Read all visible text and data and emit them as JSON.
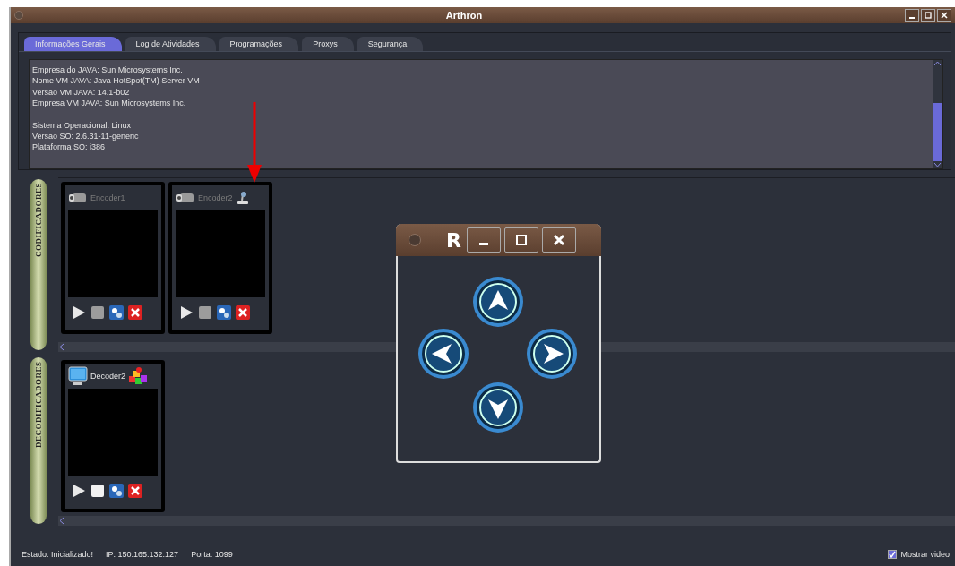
{
  "window": {
    "title": "Arthron"
  },
  "tabs": [
    {
      "label": "Informações Gerais",
      "selected": true
    },
    {
      "label": "Log de Atividades",
      "selected": false
    },
    {
      "label": "Programações",
      "selected": false
    },
    {
      "label": "Proxys",
      "selected": false
    },
    {
      "label": "Segurança",
      "selected": false
    }
  ],
  "info_blocks": [
    [
      "Empresa do JAVA: Sun Microsystems Inc.",
      "Nome VM JAVA: Java HotSpot(TM) Server VM",
      "Versao VM JAVA: 14.1-b02",
      "Empresa VM JAVA: Sun Microsystems Inc."
    ],
    [
      "Sistema Operacional: Linux",
      "Versao SO: 2.6.31-11-generic",
      "Plataforma SO: i386"
    ]
  ],
  "sections": [
    {
      "label": "CODIFICADORES",
      "devices": [
        {
          "name": "Encoder1",
          "kind": "encoder",
          "stop_enabled": false
        },
        {
          "name": "Encoder2",
          "kind": "encoder",
          "badge": {
            "kind": "controller"
          },
          "stop_enabled": false
        }
      ]
    },
    {
      "label": "DECODIFICADORES",
      "devices": [
        {
          "name": "Decoder2",
          "kind": "decoder",
          "badge": {
            "kind": "cubes"
          },
          "stop_enabled": true
        }
      ]
    }
  ],
  "control_window": {
    "logo": "R"
  },
  "status_bar": {
    "state": "Estado: Inicializado!",
    "ip": "IP: 150.165.132.127",
    "port": "Porta: 1099",
    "show_video": {
      "label": "Mostrar video",
      "checked": true
    }
  }
}
